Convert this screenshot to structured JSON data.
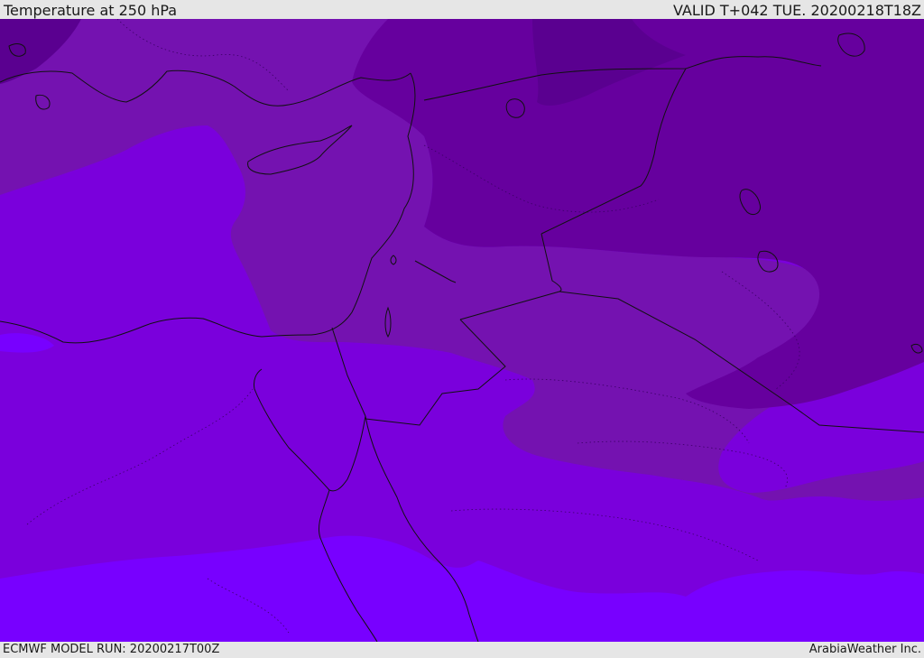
{
  "header": {
    "title": "Temperature at 250 hPa",
    "valid": "VALID T+042 TUE. 20200218T18Z"
  },
  "footer": {
    "model_run": "ECMWF MODEL RUN: 20200217T00Z",
    "provider": "ArabiaWeather Inc."
  },
  "map": {
    "variable": "Temperature",
    "level": "250 hPa",
    "colors": {
      "coldest": "#5a0090",
      "colder": "#66009e",
      "cold": "#7412b0",
      "mid": "#7a00dc",
      "warm": "#7800ff",
      "border": "#111111"
    }
  }
}
